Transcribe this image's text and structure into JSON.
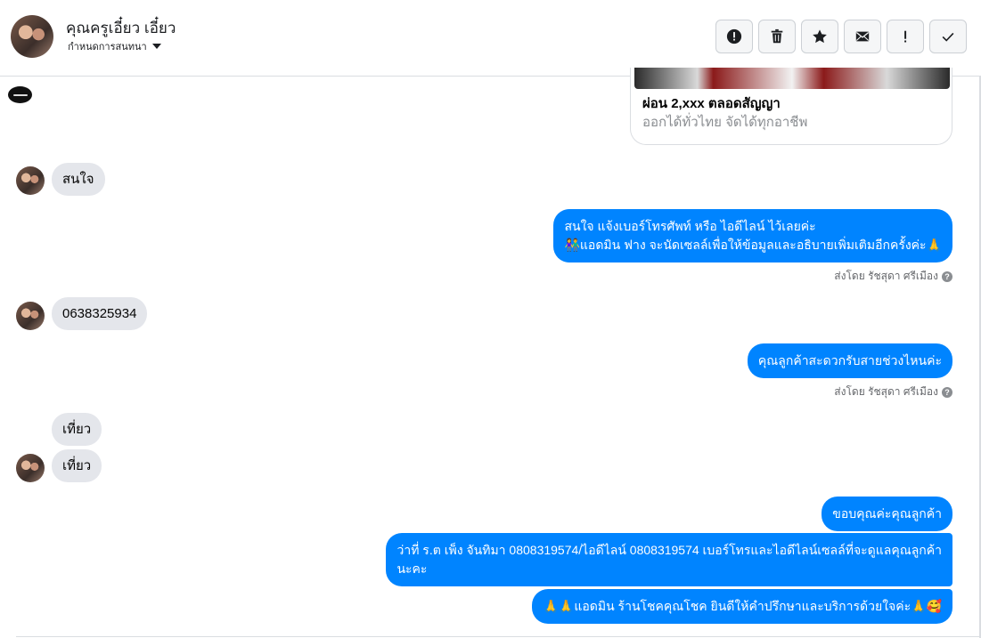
{
  "header": {
    "name": "คุณครูเอี๋ยว เอี๋ยว",
    "subtitle": "กำหนดการสนทนา",
    "actions": [
      {
        "name": "report-button",
        "icon": "alert-circle-icon"
      },
      {
        "name": "delete-button",
        "icon": "trash-icon"
      },
      {
        "name": "star-button",
        "icon": "star-icon"
      },
      {
        "name": "mark-unread-button",
        "icon": "envelope-icon"
      },
      {
        "name": "spam-button",
        "icon": "exclamation-icon"
      },
      {
        "name": "done-button",
        "icon": "check-icon"
      }
    ]
  },
  "card": {
    "title": "ผ่อน 2,xxx ตลอดสัญญา",
    "subtitle": "ออกได้ทั่วไทย จัดได้ทุกอาชีพ"
  },
  "messages": {
    "m1": "สนใจ",
    "m2_line1": "สนใจ แจ้งเบอร์โทรศัพท์ หรือ ไอดีไลน์  ไว้เลยค่ะ",
    "m2_line2": "👫แอดมิน ฟาง จะนัดเซลล์เพื่อให้ข้อมูลและอธิบายเพิ่มเติมอีกครั้งค่ะ🙏",
    "sent_by_1": "ส่งโดย รัชสุดา ศรีเมือง",
    "m3": "0638325934",
    "m4": "คุณลูกค้าสะดวกรับสายช่วงไหนค่ะ",
    "sent_by_2": "ส่งโดย รัชสุดา ศรีเมือง",
    "m5": "เที่ยว",
    "m6": "เที่ยว",
    "m7": "ขอบคุณค่ะคุณลูกค้า",
    "m8_line1": "ว่าที่ ร.ต เพ็ง จันทิมา      0808319574/ไอดีไลน์ 0808319574  เบอร์โทรและไอดีไลน์เซลล์ที่จะดูแลคุณลูกค้า",
    "m8_line2": "นะคะ",
    "m9": "🙏🙏แอดมิน ร้านโชคคุณโชค ยินดีให้คำปรึกษาและบริการด้วยใจค่ะ🙏🥰"
  },
  "colors": {
    "outgoing": "#0084ff",
    "incoming": "#e4e6eb"
  }
}
